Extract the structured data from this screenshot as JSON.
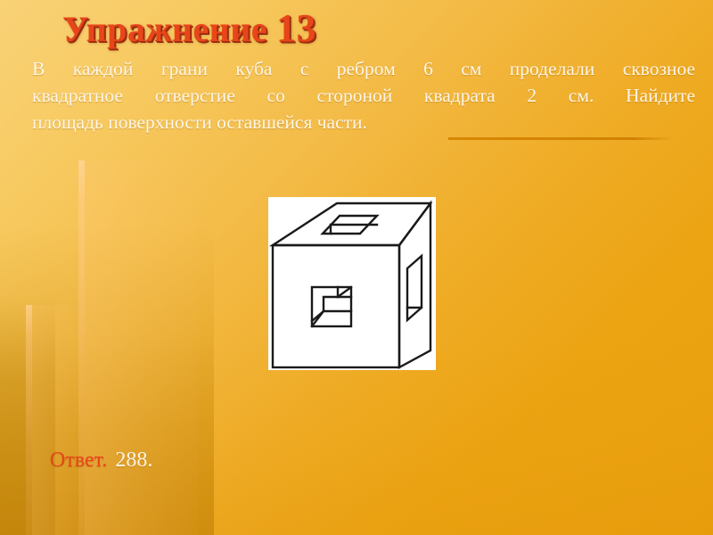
{
  "slide": {
    "title_text": "Упражнение",
    "title_number": "13",
    "problem_lines": [
      "В каждой грани куба с ребром 6 см проделали сквозное",
      "квадратное отверстие со стороной квадрата 2 см. Найдите",
      "площадь поверхности оставшейся части."
    ],
    "answer_label": "Ответ.",
    "answer_value": "288.",
    "figure": {
      "caption": "cube-with-square-holes",
      "description": "Куб с квадратными сквозными отверстиями в каждой грани",
      "stroke_color": "#1a1a1a",
      "fill_color": "#ffffff"
    },
    "colors": {
      "title": "#e8461a",
      "title_shadow": "#8f2a0c",
      "body_text": "#fdf6e6",
      "answer_label": "#e8461a",
      "answer_value": "#fdf4e2",
      "background_top": "#f9d277",
      "background_bottom": "#e9a00e",
      "rule": "#d68400"
    },
    "geometry": {
      "cube_edge_cm": 6,
      "hole_side_cm": 2,
      "surface_area": 288
    }
  }
}
